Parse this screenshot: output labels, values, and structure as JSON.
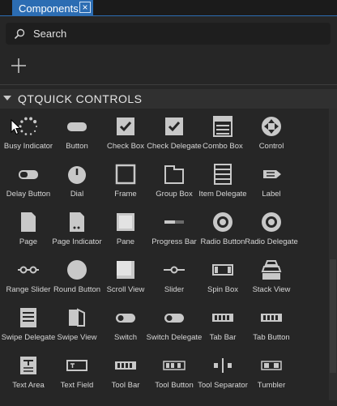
{
  "tab": {
    "title": "Components",
    "close_glyph": "×"
  },
  "search": {
    "label": "Search"
  },
  "add_icon": "plus-icon",
  "section": {
    "title": "QTQUICK CONTROLS"
  },
  "components": [
    {
      "label": "Busy Indicator",
      "icon": "busy-indicator"
    },
    {
      "label": "Button",
      "icon": "button"
    },
    {
      "label": "Check Box",
      "icon": "check-box"
    },
    {
      "label": "Check Delegate",
      "icon": "check-delegate"
    },
    {
      "label": "Combo Box",
      "icon": "combo-box"
    },
    {
      "label": "Control",
      "icon": "control"
    },
    {
      "label": "Delay Button",
      "icon": "delay-button"
    },
    {
      "label": "Dial",
      "icon": "dial"
    },
    {
      "label": "Frame",
      "icon": "frame"
    },
    {
      "label": "Group Box",
      "icon": "group-box"
    },
    {
      "label": "Item Delegate",
      "icon": "item-delegate"
    },
    {
      "label": "Label",
      "icon": "label"
    },
    {
      "label": "Page",
      "icon": "page"
    },
    {
      "label": "Page Indicator",
      "icon": "page-indicator"
    },
    {
      "label": "Pane",
      "icon": "pane"
    },
    {
      "label": "Progress Bar",
      "icon": "progress-bar"
    },
    {
      "label": "Radio Button",
      "icon": "radio-button"
    },
    {
      "label": "Radio Delegate",
      "icon": "radio-delegate"
    },
    {
      "label": "Range Slider",
      "icon": "range-slider"
    },
    {
      "label": "Round Button",
      "icon": "round-button"
    },
    {
      "label": "Scroll View",
      "icon": "scroll-view"
    },
    {
      "label": "Slider",
      "icon": "slider"
    },
    {
      "label": "Spin Box",
      "icon": "spin-box"
    },
    {
      "label": "Stack View",
      "icon": "stack-view"
    },
    {
      "label": "Swipe Delegate",
      "icon": "swipe-delegate"
    },
    {
      "label": "Swipe View",
      "icon": "swipe-view"
    },
    {
      "label": "Switch",
      "icon": "switch"
    },
    {
      "label": "Switch Delegate",
      "icon": "switch-delegate"
    },
    {
      "label": "Tab Bar",
      "icon": "tab-bar"
    },
    {
      "label": "Tab Button",
      "icon": "tab-button"
    },
    {
      "label": "Text Area",
      "icon": "text-area"
    },
    {
      "label": "Text Field",
      "icon": "text-field"
    },
    {
      "label": "Tool Bar",
      "icon": "tool-bar"
    },
    {
      "label": "Tool Button",
      "icon": "tool-button"
    },
    {
      "label": "Tool Separator",
      "icon": "tool-separator"
    },
    {
      "label": "Tumbler",
      "icon": "tumbler"
    }
  ],
  "colors": {
    "accent": "#2c6db3",
    "icon": "#c8c8c8",
    "background": "#262626"
  }
}
